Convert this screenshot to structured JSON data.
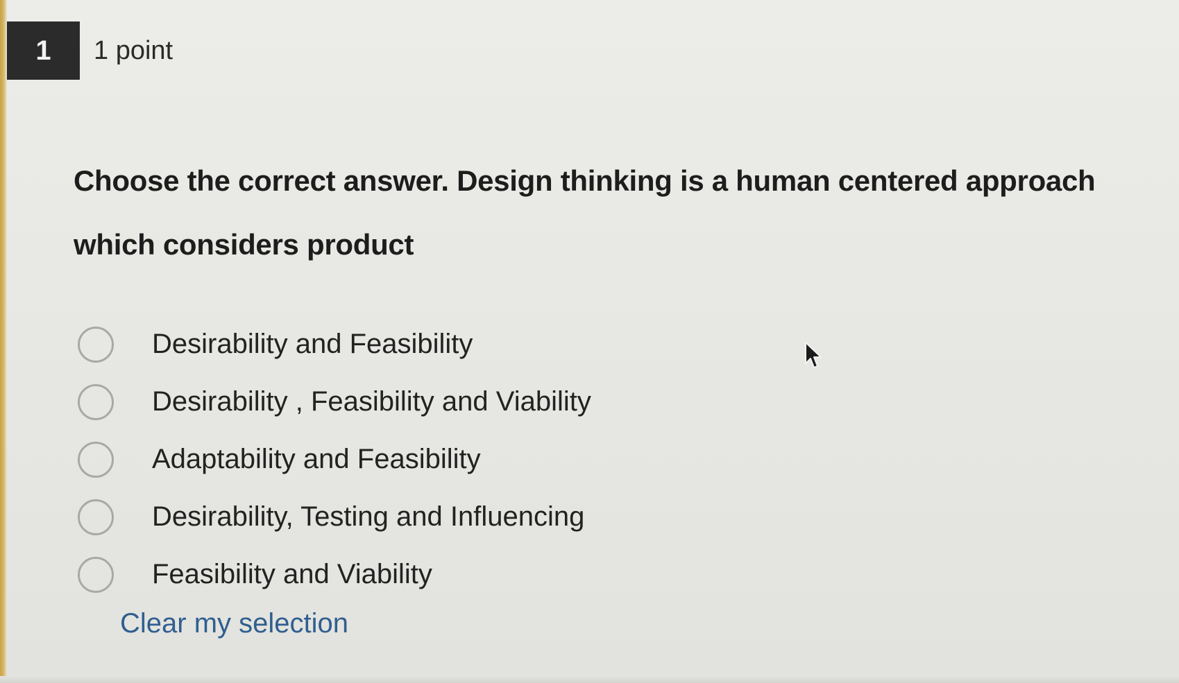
{
  "question": {
    "number": "1",
    "points": "1 point",
    "text": "Choose the correct answer. Design thinking is a human centered approach which considers product"
  },
  "options": [
    {
      "label": "Desirability and Feasibility",
      "selected": false
    },
    {
      "label": "Desirability , Feasibility and Viability",
      "selected": false
    },
    {
      "label": "Adaptability and Feasibility",
      "selected": false
    },
    {
      "label": "Desirability, Testing and Influencing",
      "selected": false
    },
    {
      "label": "Feasibility and Viability",
      "selected": false
    }
  ],
  "clear_selection_label": "Clear my selection",
  "colors": {
    "link": "#2f5f8f",
    "number_box": "#2b2b2b",
    "radio_border": "#a8a8a6"
  },
  "icons": {
    "cursor": "mouse-pointer-icon"
  }
}
